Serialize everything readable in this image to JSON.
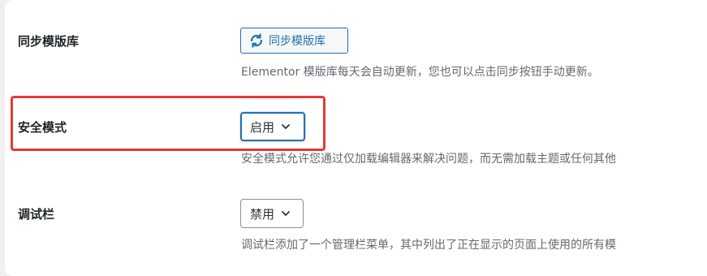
{
  "settings": {
    "sync_library": {
      "label": "同步模版库",
      "button_label": "同步模版库",
      "description": "Elementor 模版库每天会自动更新，您也可以点击同步按钮手动更新。"
    },
    "safe_mode": {
      "label": "安全模式",
      "selected_value": "启用",
      "description": "安全模式允许您通过仅加载编辑器来解决问题，而无需加载主题或任何其他"
    },
    "debug_bar": {
      "label": "调试栏",
      "selected_value": "禁用",
      "description": "调试栏添加了一个管理栏菜单，其中列出了正在显示的页面上使用的所有模"
    }
  },
  "colors": {
    "accent": "#2271b1",
    "highlight": "#e53935",
    "description_text": "#646970"
  },
  "icons": {
    "sync": "sync-icon",
    "dropdown": "chevron-down-icon"
  }
}
